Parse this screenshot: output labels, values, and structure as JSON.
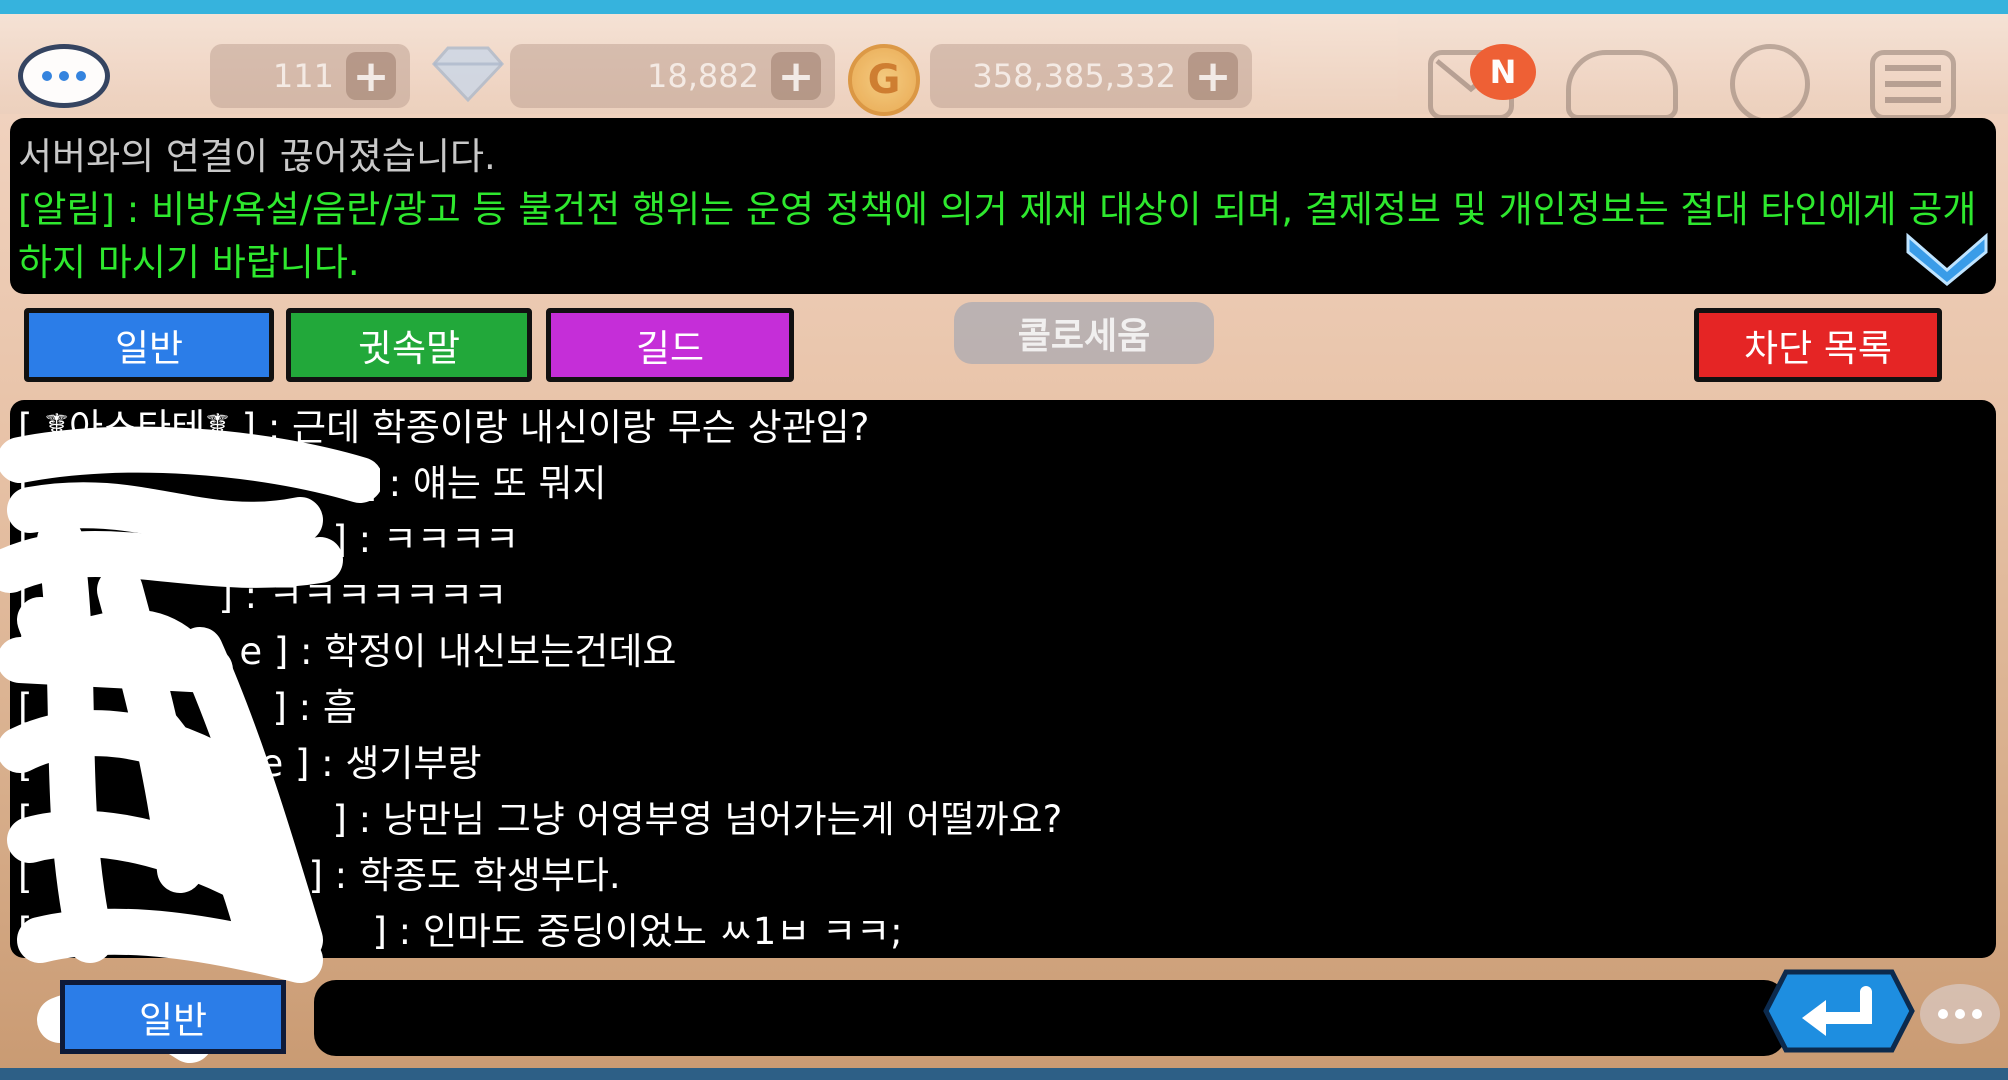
{
  "hud": {
    "resources": [
      {
        "name": "hearts",
        "value": "111"
      },
      {
        "name": "gems",
        "value": "18,882"
      },
      {
        "name": "gold",
        "value": "358,385,332"
      }
    ],
    "plus_label": "+",
    "coin_label": "G",
    "mail_badge": "N",
    "icons": [
      "chat-bubble-icon",
      "gem-icon",
      "gold-coin-icon",
      "mail-icon",
      "farm-icon",
      "compass-icon",
      "menu-icon"
    ]
  },
  "notice": {
    "system_message": "서버와의 연결이 끊어졌습니다.",
    "alert_message": "[알림] : 비방/욕설/음란/광고 등 불건전 행위는 운영 정책에 의거 제재 대상이 되며, 결제정보 및 개인정보는 절대 타인에게 공개하지 마시기 바랍니다."
  },
  "tabs": {
    "general": "일반",
    "whisper": "귓속말",
    "guild": "길드",
    "block_list": "차단 목록",
    "banner": "콜로세움"
  },
  "colors": {
    "general": "#2b7de8",
    "whisper": "#22a83a",
    "guild": "#c52ed8",
    "block_list": "#e52525",
    "alert_text": "#2ee82e"
  },
  "chat": [
    {
      "sender": "[ ☤아스타테☤ ]",
      "text": " : 근데 학종이랑 내신이랑 무슨 상관임?"
    },
    {
      "sender": "[",
      "text": "] : 얘는 또 뭐지"
    },
    {
      "sender": "[",
      "text": "] : ㅋㅋㅋㅋ"
    },
    {
      "sender": "[",
      "text": "] : ㅋㅋㅋㅋㅋㅋㅋ"
    },
    {
      "sender": "[Pr",
      "text": "e ] : 학정이 내신보는건데요"
    },
    {
      "sender": "[",
      "text": "] : 흠"
    },
    {
      "sender": "[",
      "text": "e ] : 생기부랑"
    },
    {
      "sender": "[",
      "text": "] : 낭만님 그냥 어영부영 넘어가는게 어떨까요?"
    },
    {
      "sender": "[",
      "text": "] : 학종도 학생부다."
    },
    {
      "sender": "[",
      "text": "] : 인마도 중딩이었노 ㅆ1ㅂ ㅋㅋ;"
    }
  ],
  "input": {
    "channel": "일반",
    "value": "",
    "placeholder": ""
  }
}
